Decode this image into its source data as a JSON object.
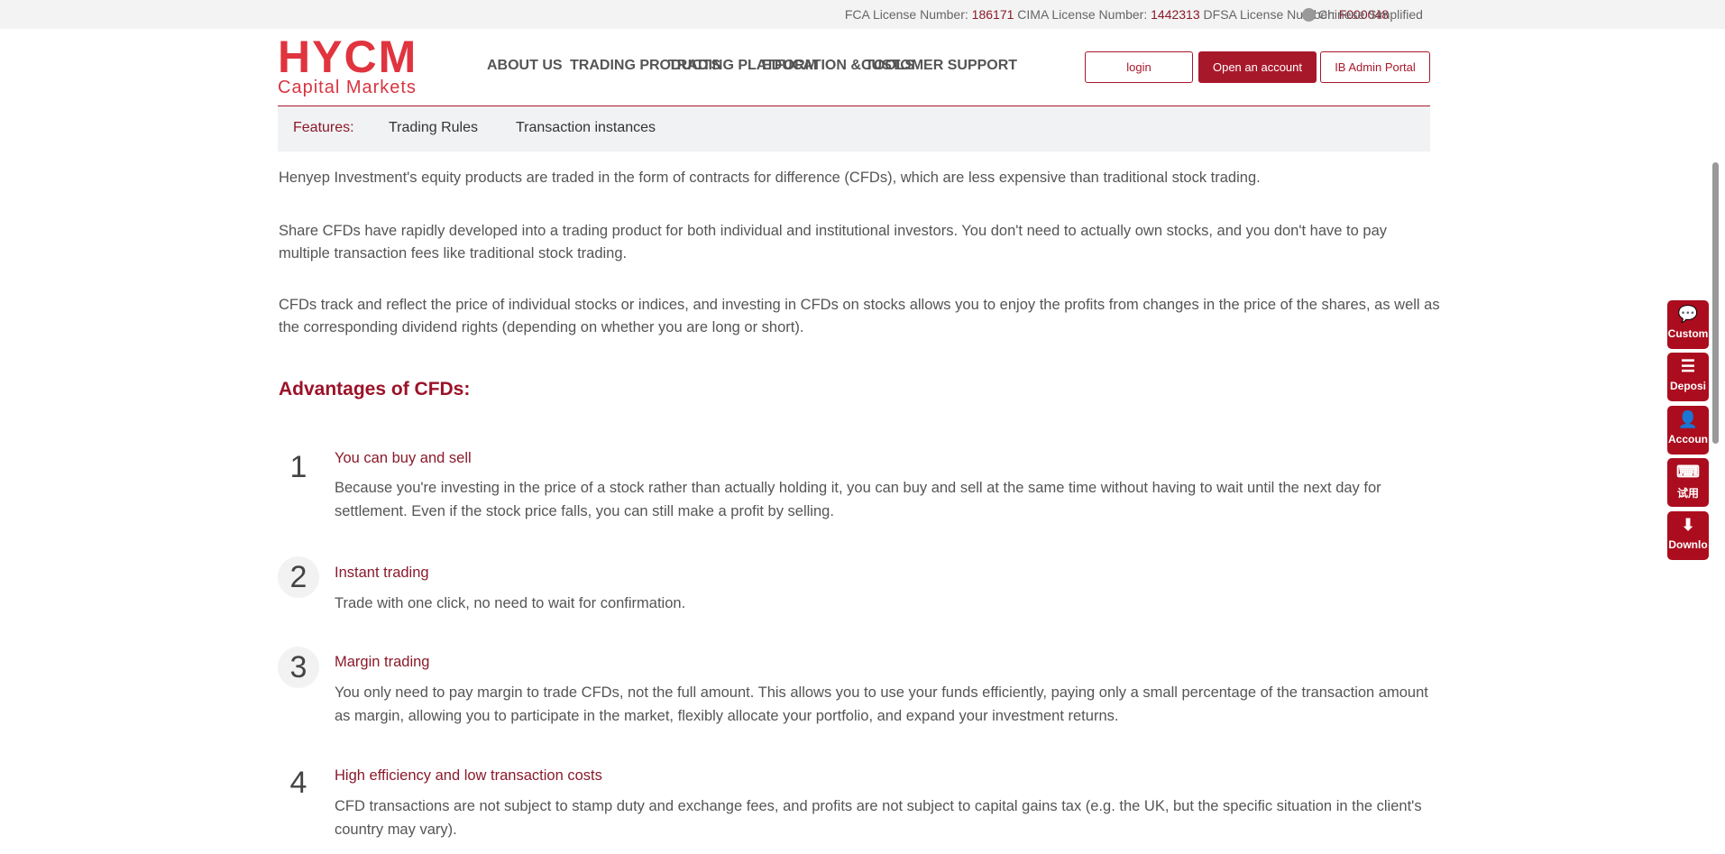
{
  "topbar": {
    "fca_label": "FCA License Number:",
    "fca": "186171",
    "cima_label": "CIMA License Number:",
    "cima": "1442313",
    "dfsa_label": "DFSA License Number:",
    "dfsa": "F000048",
    "language": "Chinese Simplified"
  },
  "logo": {
    "brand": "HYCM",
    "sub": "Capital Markets"
  },
  "nav": [
    "ABOUT US",
    "TRADING PRODUCTS",
    "TRADING PLATFORM",
    "EDUCATION & TOOLS",
    "CUSTOMER SUPPORT"
  ],
  "buttons": {
    "login": "login",
    "open": "Open an account",
    "ib": "IB Admin Portal"
  },
  "subnav": [
    "Features:",
    "Trading Rules",
    "Transaction instances"
  ],
  "paragraphs": [
    "Henyep Investment's equity products are traded in the form of contracts for difference (CFDs), which are less expensive than traditional stock trading.",
    "Share CFDs have rapidly developed into a trading product for both individual and institutional investors. You don't need to actually own stocks, and you don't have to pay multiple transaction fees like traditional stock trading.",
    "CFDs track and reflect the price of individual stocks or indices, and investing in CFDs on stocks allows you to enjoy the profits from changes in the price of the shares, as well as the corresponding dividend rights (depending on whether you are long or short)."
  ],
  "advantages_heading": "Advantages of CFDs:",
  "advantages": [
    {
      "num": "1",
      "title": "You can buy and sell",
      "body": "Because you're investing in the price of a stock rather than actually holding it, you can buy and sell at the same time without having to wait until the next day for settlement. Even if the stock price falls, you can still make a profit by selling."
    },
    {
      "num": "2",
      "title": "Instant trading",
      "body": "Trade with one click, no need to wait for confirmation."
    },
    {
      "num": "3",
      "title": "Margin trading",
      "body": "You only need to pay margin to trade CFDs, not the full amount. This allows you to use your funds efficiently, paying only a small percentage of the transaction amount as margin, allowing you to participate in the market, flexibly allocate your portfolio, and expand your investment returns."
    },
    {
      "num": "4",
      "title": "High efficiency and low transaction costs",
      "body": "CFD transactions are not subject to stamp duty and exchange fees, and profits are not subject to capital gains tax (e.g. the UK, but the specific situation in the client's country may vary)."
    }
  ],
  "side": [
    {
      "label": "Custom",
      "icon": "chat-icon"
    },
    {
      "label": "Deposi",
      "icon": "coins-icon"
    },
    {
      "label": "Accoun",
      "icon": "add-user-icon"
    },
    {
      "label": "试用",
      "icon": "keyboard-icon"
    },
    {
      "label": "Downlo",
      "icon": "download-icon"
    }
  ],
  "colors": {
    "brand": "#a8182b",
    "logo": "#e0343f"
  }
}
